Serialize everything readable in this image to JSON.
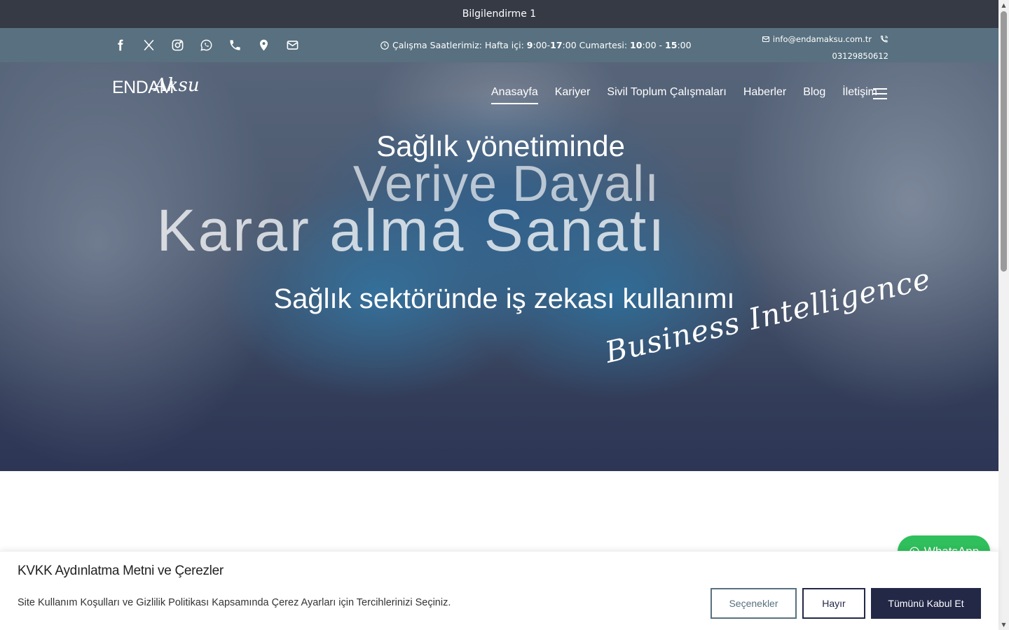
{
  "announcement": {
    "text": "Bilgilendirme 1"
  },
  "topbar": {
    "socials": [
      "facebook-icon",
      "x-twitter-icon",
      "instagram-icon",
      "whatsapp-icon",
      "phone-icon",
      "map-pin-icon",
      "envelope-icon"
    ],
    "hours": {
      "prefix": "Çalışma Saatlerimiz: Hafta içi:",
      "wd_start_h": "9",
      "wd_start_m": ":00-",
      "wd_end_h": "17",
      "wd_end_m": ":00 Cumartesi:",
      "sat_start_h": "10",
      "sat_start_m": ":00 -",
      "sat_end_h": "15",
      "sat_end_m": ":00"
    },
    "email": "info@endamaksu.com.tr",
    "phone": "03129850612"
  },
  "logo": {
    "word": "ENDAM",
    "script": "Aksu"
  },
  "nav": {
    "items": [
      "Anasayfa",
      "Kariyer",
      "Sivil Toplum Çalışmaları",
      "Haberler",
      "Blog",
      "İletişim"
    ],
    "active": "Anasayfa"
  },
  "hero": {
    "line1": "Sağlık yönetiminde",
    "line2": "Veriye Dayalı",
    "line3": "Karar alma Sanatı",
    "line4": "Sağlık sektöründe iş zekası kullanımı",
    "script": "Business Intelligence"
  },
  "whatsapp": {
    "label": "WhatsApp"
  },
  "cookie": {
    "title": "KVKK Aydınlatma Metni ve Çerezler",
    "description": "Site Kullanım Koşulları ve Gizlilik Politikası Kapsamında Çerez Ayarları için Tercihlerinizi Seçiniz.",
    "options_label": "Seçenekler",
    "no_label": "Hayır",
    "accept_all_label": "Tümünü Kabul Et"
  },
  "colors": {
    "announcement_bg": "#353a45",
    "topbar_bg": "#58707f",
    "brand_dark": "#232847",
    "whatsapp_green": "#2fbf5c"
  }
}
